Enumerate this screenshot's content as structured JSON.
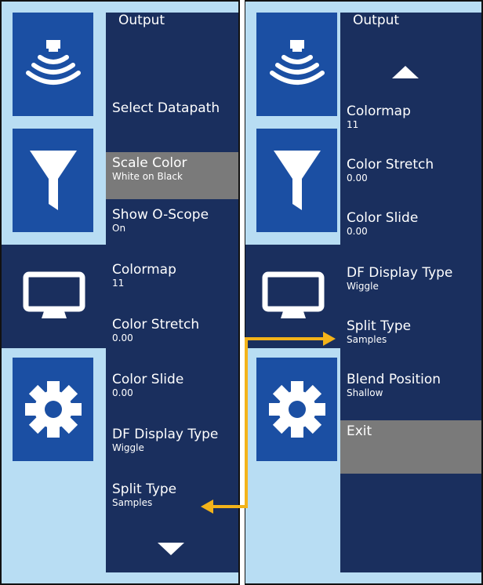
{
  "colors": {
    "accent": "#f3b31a",
    "panel_bg": "#b8ddf3",
    "menu_bg": "#1a2f5e",
    "tile": "#1b4fa3",
    "highlight": "#7a7a7a"
  },
  "icons": [
    "sonar-icon",
    "filter-icon",
    "monitor-icon",
    "gear-icon"
  ],
  "left_menu": {
    "title": "Output",
    "items": [
      {
        "label": "Select Datapath",
        "value": ""
      },
      {
        "label": "Scale Color",
        "value": "White on Black"
      },
      {
        "label": "Show O-Scope",
        "value": "On"
      },
      {
        "label": "Colormap",
        "value": "11"
      },
      {
        "label": "Color Stretch",
        "value": "0.00"
      },
      {
        "label": "Color Slide",
        "value": "0.00"
      },
      {
        "label": "DF Display Type",
        "value": "Wiggle"
      },
      {
        "label": "Split Type",
        "value": "Samples"
      }
    ]
  },
  "right_menu": {
    "title": "Output",
    "items": [
      {
        "label": "Colormap",
        "value": "11"
      },
      {
        "label": "Color Stretch",
        "value": "0.00"
      },
      {
        "label": "Color Slide",
        "value": "0.00"
      },
      {
        "label": "DF Display Type",
        "value": "Wiggle"
      },
      {
        "label": "Split Type",
        "value": "Samples"
      },
      {
        "label": "Blend Position",
        "value": "Shallow"
      },
      {
        "label": "Exit",
        "value": ""
      }
    ]
  }
}
